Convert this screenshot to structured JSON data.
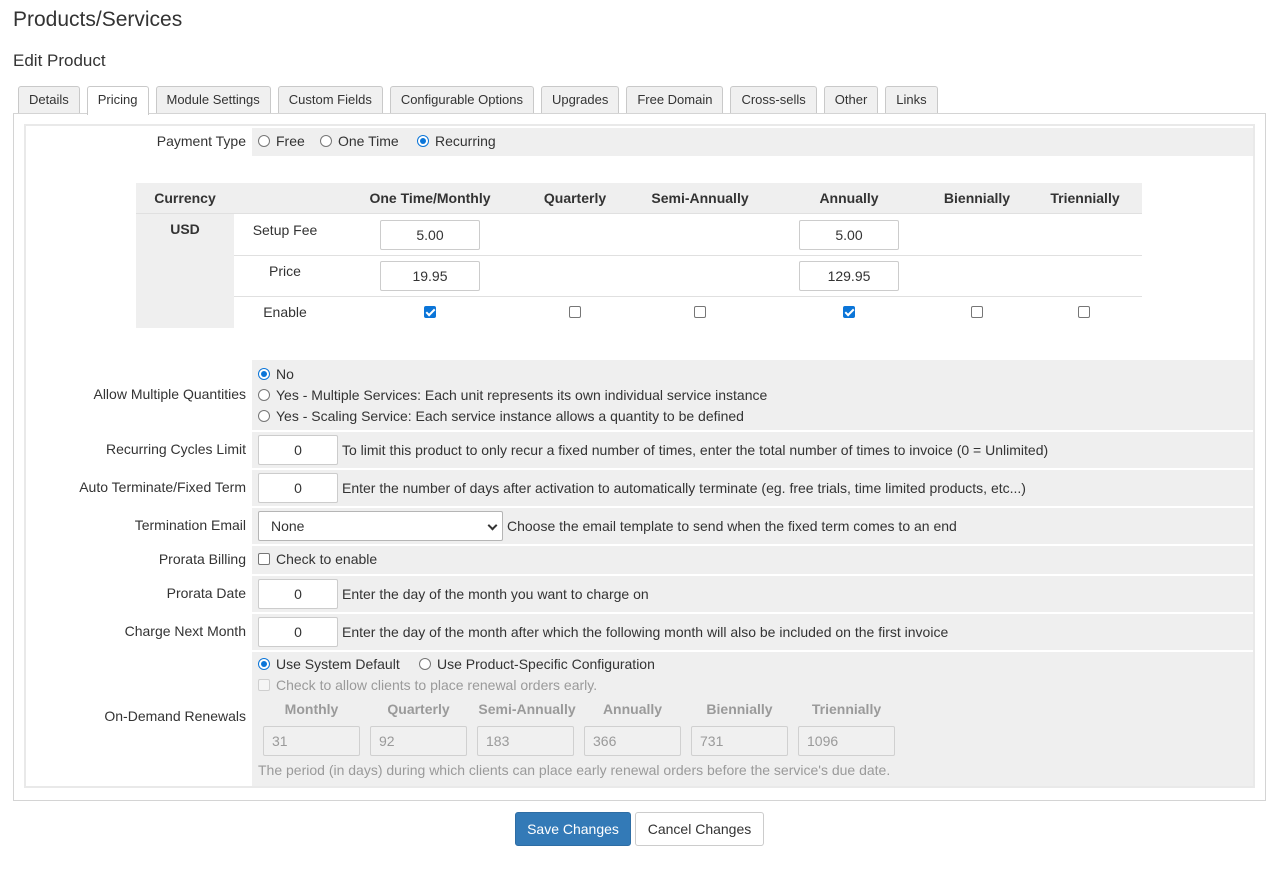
{
  "header": {
    "title": "Products/Services",
    "subtitle": "Edit Product"
  },
  "tabs": [
    {
      "label": "Details"
    },
    {
      "label": "Pricing"
    },
    {
      "label": "Module Settings"
    },
    {
      "label": "Custom Fields"
    },
    {
      "label": "Configurable Options"
    },
    {
      "label": "Upgrades"
    },
    {
      "label": "Free Domain"
    },
    {
      "label": "Cross-sells"
    },
    {
      "label": "Other"
    },
    {
      "label": "Links"
    }
  ],
  "active_tab": "Pricing",
  "payment_type": {
    "label": "Payment Type",
    "options": [
      "Free",
      "One Time",
      "Recurring"
    ],
    "selected": "Recurring"
  },
  "pricing": {
    "headers": [
      "Currency",
      "One Time/Monthly",
      "Quarterly",
      "Semi-Annually",
      "Annually",
      "Biennially",
      "Triennially"
    ],
    "currency": "USD",
    "setup_fee_label": "Setup Fee",
    "price_label": "Price",
    "enable_label": "Enable",
    "setup_fee": {
      "monthly": "5.00",
      "annually": "5.00"
    },
    "price": {
      "monthly": "19.95",
      "annually": "129.95"
    },
    "enabled": [
      true,
      false,
      false,
      true,
      false,
      false
    ]
  },
  "multiple_quantities": {
    "label": "Allow Multiple Quantities",
    "options": [
      "No",
      "Yes - Multiple Services: Each unit represents its own individual service instance",
      "Yes - Scaling Service: Each service instance allows a quantity to be defined"
    ],
    "selected": "No"
  },
  "recurring_cycles": {
    "label": "Recurring Cycles Limit",
    "value": "0",
    "hint": "To limit this product to only recur a fixed number of times, enter the total number of times to invoice (0 = Unlimited)"
  },
  "auto_terminate": {
    "label": "Auto Terminate/Fixed Term",
    "value": "0",
    "hint": "Enter the number of days after activation to automatically terminate (eg. free trials, time limited products, etc...)"
  },
  "termination_email": {
    "label": "Termination Email",
    "value": "None",
    "hint": "Choose the email template to send when the fixed term comes to an end"
  },
  "prorata_billing": {
    "label": "Prorata Billing",
    "checkbox_label": "Check to enable",
    "checked": false
  },
  "prorata_date": {
    "label": "Prorata Date",
    "value": "0",
    "hint": "Enter the day of the month you want to charge on"
  },
  "charge_next_month": {
    "label": "Charge Next Month",
    "value": "0",
    "hint": "Enter the day of the month after which the following month will also be included on the first invoice"
  },
  "on_demand": {
    "label": "On-Demand Renewals",
    "options": [
      "Use System Default",
      "Use Product-Specific Configuration"
    ],
    "selected": "Use System Default",
    "early_label": "Check to allow clients to place renewal orders early.",
    "periods": [
      {
        "name": "Monthly",
        "value": "31"
      },
      {
        "name": "Quarterly",
        "value": "92"
      },
      {
        "name": "Semi-Annually",
        "value": "183"
      },
      {
        "name": "Annually",
        "value": "366"
      },
      {
        "name": "Biennially",
        "value": "731"
      },
      {
        "name": "Triennially",
        "value": "1096"
      }
    ],
    "footnote": "The period (in days) during which clients can place early renewal orders before the service's due date."
  },
  "actions": {
    "save": "Save Changes",
    "cancel": "Cancel Changes"
  },
  "colors": {
    "primary": "#337ab7",
    "radio_accent": "#0b75d8",
    "field_bg": "#efefef"
  }
}
